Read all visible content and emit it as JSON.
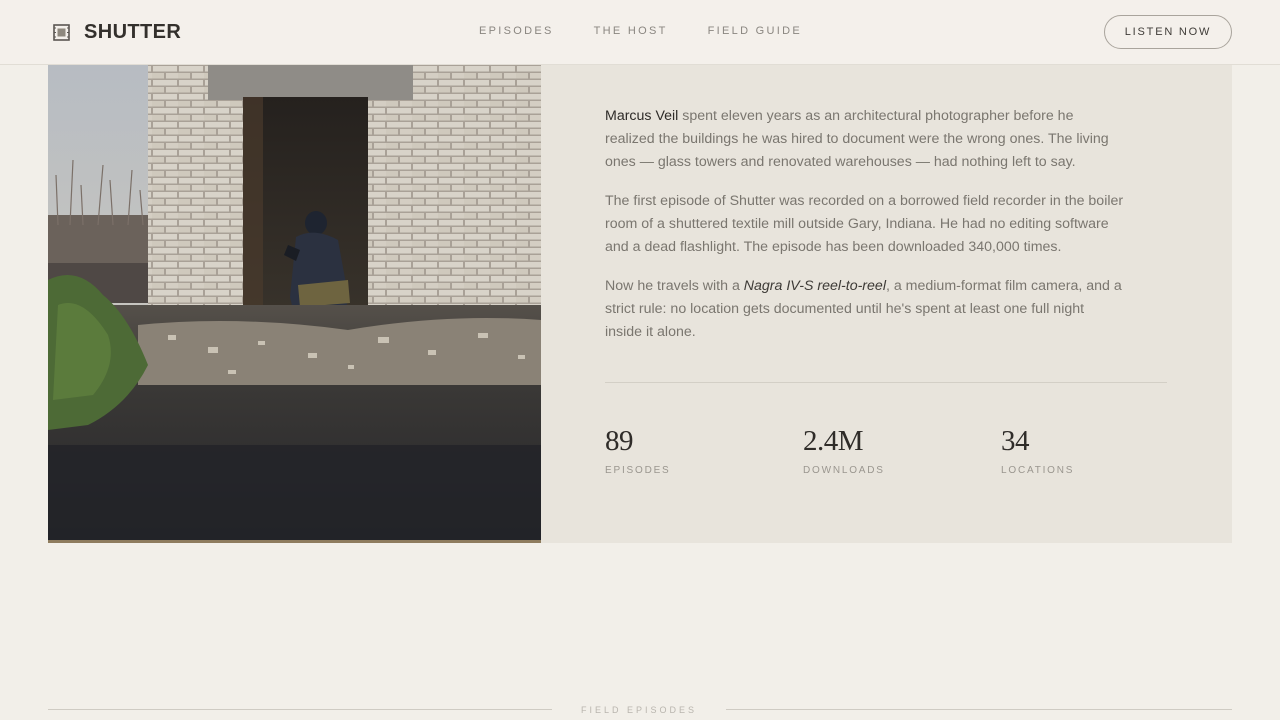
{
  "brand": {
    "name": "SHUTTER",
    "icon": "film-frame-icon"
  },
  "nav": {
    "items": [
      {
        "label": "EPISODES"
      },
      {
        "label": "THE HOST"
      },
      {
        "label": "FIELD GUIDE"
      }
    ],
    "cta_label": "LISTEN NOW"
  },
  "hero": {
    "image_alt": "Person crouching inside the doorway of a ruined brick building",
    "bio": {
      "p1_name": "Marcus Veil",
      "p1_rest": " spent eleven years as an architectural photographer before he realized the buildings he was hired to document were the wrong ones. The living ones — glass towers and renovated warehouses — had nothing left to say.",
      "p2": "The first episode of Shutter was recorded on a borrowed field recorder in the boiler room of a shuttered textile mill outside Gary, Indiana. He had no editing software and a dead flashlight. The episode has been downloaded 340,000 times.",
      "p3_before": "Now he travels with a ",
      "p3_em": "Nagra IV-S reel-to-reel",
      "p3_after": ", a medium-format film camera, and a strict rule: no location gets documented until he's spent at least one full night inside it alone."
    },
    "stats": [
      {
        "value": "89",
        "label": "EPISODES"
      },
      {
        "value": "2.4M",
        "label": "DOWNLOADS"
      },
      {
        "value": "34",
        "label": "LOCATIONS"
      }
    ]
  },
  "section": {
    "label": "FIELD EPISODES"
  },
  "colors": {
    "background": "#f2efe9",
    "panel": "#e8e4dc",
    "text_dark": "#2e2b28",
    "text_muted": "#7a766f",
    "photo_accent": "#8e7c5e"
  }
}
